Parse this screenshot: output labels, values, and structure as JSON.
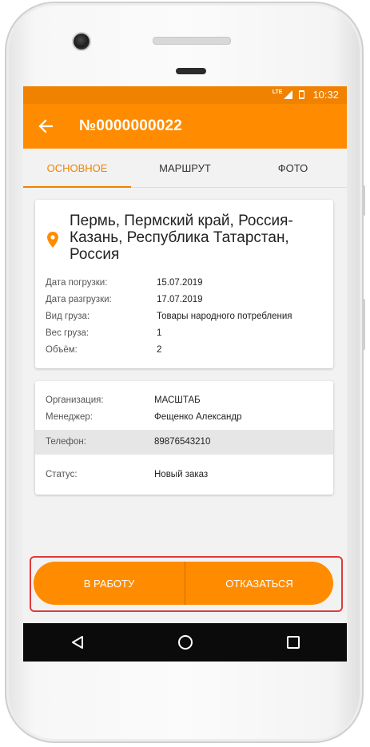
{
  "status_bar": {
    "network": "LTE",
    "time": "10:32"
  },
  "app_bar": {
    "title": "№0000000022"
  },
  "tabs": [
    {
      "label": "ОСНОВНОЕ",
      "active": true
    },
    {
      "label": "МАРШРУТ",
      "active": false
    },
    {
      "label": "ФОТО",
      "active": false
    }
  ],
  "cargo_card": {
    "route": "Пермь, Пермский край, Россия-Казань, Республика Татарстан, Россия",
    "rows": [
      {
        "label": "Дата погрузки:",
        "value": "15.07.2019"
      },
      {
        "label": "Дата разгрузки:",
        "value": "17.07.2019"
      },
      {
        "label": "Вид груза:",
        "value": "Товары народного потребления"
      },
      {
        "label": "Вес груза:",
        "value": "1"
      },
      {
        "label": "Объём:",
        "value": "2"
      }
    ]
  },
  "org_card": {
    "organization_label": "Организация:",
    "organization_value": "МАСШТАБ",
    "manager_label": "Менеджер:",
    "manager_value": "Фещенко Александр",
    "phone_label": "Телефон:",
    "phone_value": "89876543210",
    "status_label": "Статус:",
    "status_value": "Новый заказ"
  },
  "actions": {
    "accept_label": "В РАБОТУ",
    "decline_label": "ОТКАЗАТЬСЯ"
  },
  "colors": {
    "accent": "#ff8c00",
    "status_bar": "#f08200",
    "highlight": "#e13a3a",
    "nav_bar": "#0b0b0b"
  },
  "icons": {
    "back": "arrow-left-icon",
    "location": "location-pin-icon",
    "nav_back": "triangle-back-icon",
    "nav_home": "circle-home-icon",
    "nav_recent": "square-recent-icon"
  }
}
